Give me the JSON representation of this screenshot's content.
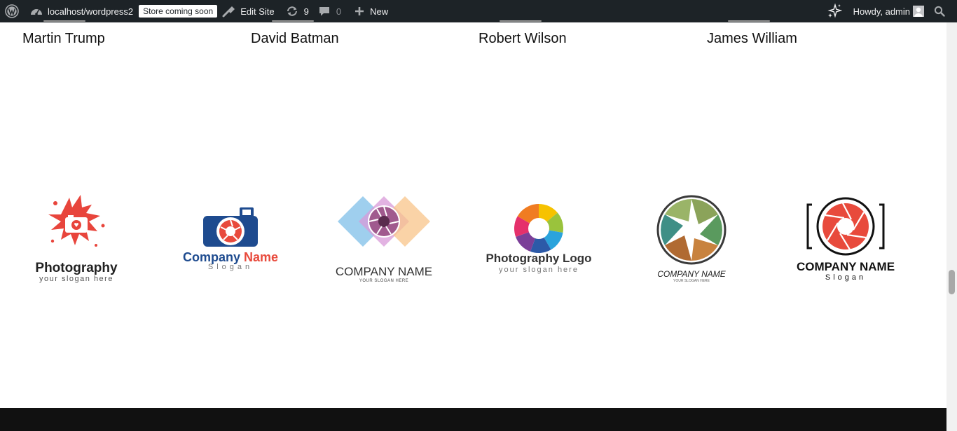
{
  "admin_bar": {
    "wp_logo_icon": "wordpress-icon",
    "site_name": "localhost/wordpress2",
    "store_badge": "Store coming soon",
    "edit_site": "Edit Site",
    "updates_count": "9",
    "comments_count": "0",
    "new_label": "New",
    "howdy": "Howdy, admin"
  },
  "team": {
    "members": [
      "Martin Trump",
      "David Batman",
      "Robert Wilson",
      "James William"
    ]
  },
  "logos": [
    {
      "line1": "Photography",
      "line2": "your slogan here",
      "icon": "paint-splash-camera-icon"
    },
    {
      "line1a": "Company ",
      "line1b": "Name",
      "line2": "Slogan",
      "icon": "blue-camera-icon"
    },
    {
      "line1": "COMPANY NAME",
      "line2": "YOUR SLOGAN HERE",
      "icon": "overlapping-diamonds-aperture-icon"
    },
    {
      "line1": "Photography Logo",
      "line2": "your slogan here",
      "icon": "rainbow-aperture-icon"
    },
    {
      "line1": "COMPANY NAME",
      "line2": "YOUR SLOGAN HERE",
      "icon": "green-orange-aperture-icon"
    },
    {
      "line1": "COMPANY NAME",
      "line2": "Slogan",
      "icon": "red-aperture-frame-icon"
    }
  ],
  "colors": {
    "admin_bar_bg": "#1d2327",
    "footer_bg": "#111111",
    "brand_blue": "#1e4b8f",
    "brand_red": "#e84a3c"
  }
}
